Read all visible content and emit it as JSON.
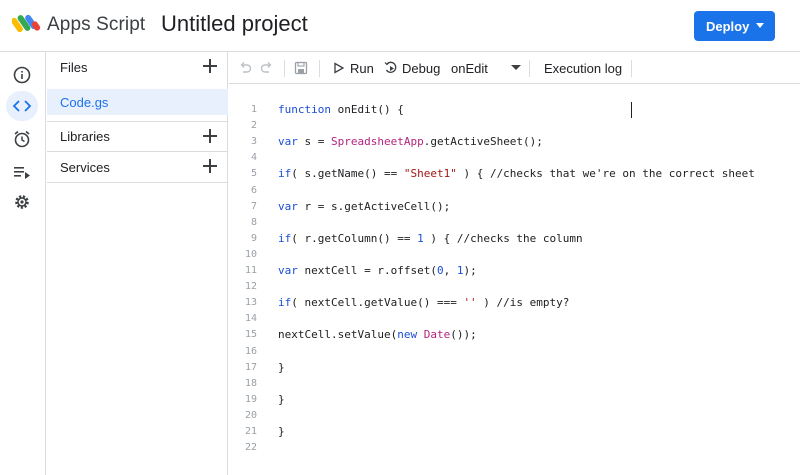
{
  "header": {
    "app_name": "Apps Script",
    "project_title": "Untitled project",
    "deploy_label": "Deploy"
  },
  "rail": {
    "items": [
      "info-icon",
      "code-icon",
      "clock-icon",
      "executions-icon",
      "gear-icon"
    ],
    "active_item": "code-icon"
  },
  "files_panel": {
    "files_label": "Files",
    "files": [
      "Code.gs"
    ],
    "libraries_label": "Libraries",
    "services_label": "Services"
  },
  "toolbar": {
    "run_label": "Run",
    "debug_label": "Debug",
    "function_select": "onEdit",
    "execution_log_label": "Execution log"
  },
  "editor": {
    "lines": [
      {
        "n": "1",
        "code": "function onEdit() {"
      },
      {
        "n": "2",
        "code": ""
      },
      {
        "n": "3",
        "code": "var s = SpreadsheetApp.getActiveSheet();"
      },
      {
        "n": "4",
        "code": ""
      },
      {
        "n": "5",
        "code": "if( s.getName() == \"Sheet1\" ) { //checks that we're on the correct sheet"
      },
      {
        "n": "6",
        "code": ""
      },
      {
        "n": "7",
        "code": "var r = s.getActiveCell();"
      },
      {
        "n": "8",
        "code": ""
      },
      {
        "n": "9",
        "code": "if( r.getColumn() == 1 ) { //checks the column"
      },
      {
        "n": "10",
        "code": ""
      },
      {
        "n": "11",
        "code": "var nextCell = r.offset(0, 1);"
      },
      {
        "n": "12",
        "code": ""
      },
      {
        "n": "13",
        "code": "if( nextCell.getValue() === '' ) //is empty?"
      },
      {
        "n": "14",
        "code": ""
      },
      {
        "n": "15",
        "code": "nextCell.setValue(new Date());"
      },
      {
        "n": "16",
        "code": ""
      },
      {
        "n": "17",
        "code": "}"
      },
      {
        "n": "18",
        "code": ""
      },
      {
        "n": "19",
        "code": "}"
      },
      {
        "n": "20",
        "code": ""
      },
      {
        "n": "21",
        "code": "}"
      },
      {
        "n": "22",
        "code": ""
      }
    ]
  },
  "colors": {
    "accent": "#1a73e8",
    "keyword": "#1a4ed8",
    "class_name": "#b4237e",
    "string": "#a31515"
  }
}
